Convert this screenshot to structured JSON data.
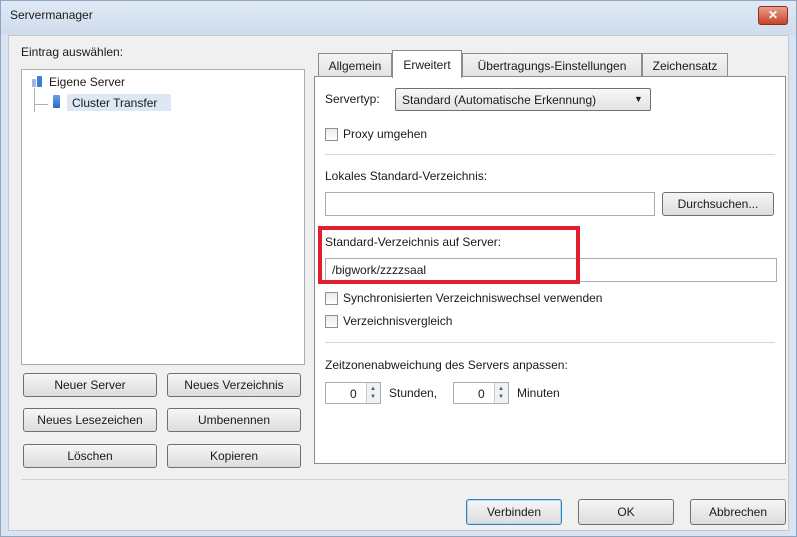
{
  "window": {
    "title": "Servermanager",
    "close_glyph": "✕"
  },
  "left": {
    "label": "Eintrag auswählen:",
    "tree": {
      "root_label": "Eigene Server",
      "child_label": "Cluster Transfer"
    },
    "buttons": {
      "new_server": "Neuer Server",
      "new_folder": "Neues Verzeichnis",
      "new_bookmark": "Neues Lesezeichen",
      "rename": "Umbenennen",
      "delete": "Löschen",
      "copy": "Kopieren"
    }
  },
  "tabs": [
    {
      "label": "Allgemein"
    },
    {
      "label": "Erweitert"
    },
    {
      "label": "Übertragungs-Einstellungen"
    },
    {
      "label": "Zeichensatz"
    }
  ],
  "advanced": {
    "servertype_label": "Servertyp:",
    "servertype_value": "Standard (Automatische Erkennung)",
    "bypass_proxy_label": "Proxy umgehen",
    "local_dir_label": "Lokales Standard-Verzeichnis:",
    "local_dir_value": "",
    "browse_label": "Durchsuchen...",
    "remote_dir_label": "Standard-Verzeichnis auf Server:",
    "remote_dir_value": "/bigwork/zzzzsaal",
    "sync_browsing_label": "Synchronisierten Verzeichniswechsel verwenden",
    "dir_compare_label": "Verzeichnisvergleich",
    "timezone_label": "Zeitzonenabweichung des Servers anpassen:",
    "hours_value": "0",
    "hours_label": "Stunden,",
    "minutes_value": "0",
    "minutes_label": "Minuten"
  },
  "footer": {
    "connect": "Verbinden",
    "ok": "OK",
    "cancel": "Abbrechen"
  },
  "colors": {
    "highlight_box": "#e0202c",
    "accent": "#3c7fb1"
  }
}
